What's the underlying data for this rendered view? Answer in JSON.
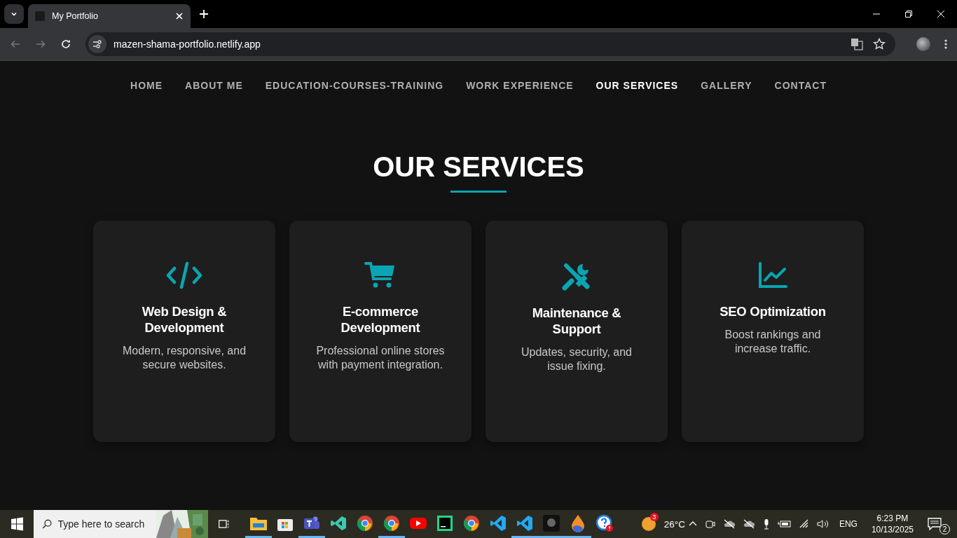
{
  "browser": {
    "tab_title": "My Portfolio",
    "url": "mazen-shama-portfolio.netlify.app"
  },
  "nav": [
    {
      "label": "HOME",
      "selected": false
    },
    {
      "label": "ABOUT ME",
      "selected": false
    },
    {
      "label": "EDUCATION-COURSES-TRAINING",
      "selected": false
    },
    {
      "label": "WORK EXPERIENCE",
      "selected": false
    },
    {
      "label": "OUR SERVICES",
      "selected": true
    },
    {
      "label": "GALLERY",
      "selected": false
    },
    {
      "label": "CONTACT",
      "selected": false
    }
  ],
  "heading": "OUR SERVICES",
  "services": [
    {
      "kind": "code",
      "title": "Web Design & Development",
      "description": "Modern, responsive, and secure websites."
    },
    {
      "kind": "cart",
      "title": "E-commerce Development",
      "description": "Professional online stores with payment integration."
    },
    {
      "kind": "tools",
      "title": "Maintenance & Support",
      "description": "Updates, security, and issue fixing."
    },
    {
      "kind": "chart",
      "title": "SEO Optimization",
      "description": "Boost rankings and increase traffic."
    }
  ],
  "taskbar": {
    "search": {
      "placeholder": "Type here to search"
    },
    "apps": [
      {
        "kind": "folder",
        "running": true
      },
      {
        "kind": "store",
        "running": false
      },
      {
        "kind": "teams",
        "running": true
      },
      {
        "kind": "vs",
        "running": false
      },
      {
        "kind": "chrome",
        "running": false
      },
      {
        "kind": "chrome",
        "running": true
      },
      {
        "kind": "youtube",
        "running": false
      },
      {
        "kind": "pycharm",
        "running": false
      },
      {
        "kind": "chrome",
        "running": false
      },
      {
        "kind": "vscode",
        "running": false
      },
      {
        "kind": "vscode",
        "running": true
      },
      {
        "kind": "dark",
        "running": true
      },
      {
        "kind": "drop",
        "running": true
      },
      {
        "kind": "help",
        "running": false
      }
    ],
    "weather": {
      "badge": "3",
      "temperature": "26°C"
    },
    "language": "ENG",
    "time": "6:23 PM",
    "date": "10/13/2025",
    "notifications": "2"
  }
}
